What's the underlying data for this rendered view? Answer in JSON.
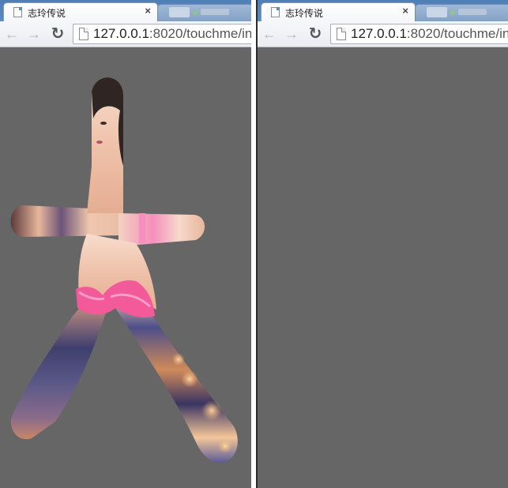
{
  "windows": [
    {
      "tab": {
        "title": "志玲传说",
        "close": "×"
      },
      "nav": {
        "back": "←",
        "forward": "→",
        "reload": "↻"
      },
      "address": {
        "host": "127.0.0.1",
        "rest": ":8020/touchme/in"
      }
    },
    {
      "tab": {
        "title": "志玲传说",
        "close": "×"
      },
      "nav": {
        "back": "←",
        "forward": "→",
        "reload": "↻"
      },
      "address": {
        "host": "127.0.0.1",
        "rest": ":8020/touchme/in"
      }
    }
  ],
  "colors": {
    "page_background": "#666666",
    "tabstrip": "#5b8ac1",
    "skin": "#f0c6b0",
    "lingerie": "#f25a9a",
    "night_lights": "#4a3a6a"
  }
}
